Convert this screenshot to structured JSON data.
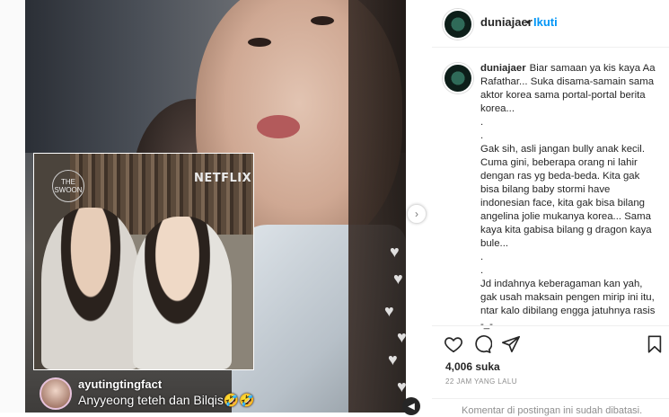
{
  "post": {
    "username": "duniajaer",
    "separator": "•",
    "follow_label": "Ikuti",
    "caption_lines": "Biar samaan ya kis kaya Aa Rafathar... Suka disama-samain sama aktor korea sama portal-portal berita korea...\n.\n.\nGak sih, asli jangan bully anak kecil. Cuma gini, beberapa orang ni lahir dengan ras yg beda-beda. Kita gak bisa bilang baby stormi have indonesian face, kita gak bisa bilang angelina jolie mukanya korea... Sama kaya kita gabisa bilang g dragon kaya bule...\n.\n.\nJd indahnya keberagaman kan yah, gak usah maksain pengen mirip ini itu, ntar kalo dibilang engga jatuhnya rasis -_-",
    "likes": "4,006 suka",
    "timestamp": "22 JAM YANG LALU",
    "comments_off": "Komentar di postingan ini sudah dibatasi."
  },
  "media": {
    "inset_brand": "NETFLIX",
    "inset_logo": "THE SWOON",
    "watermark_user": "ayutingtingfact",
    "watermark_caption": "Anyyeong teteh dan Bilqis🤣🤣"
  },
  "icons": [
    "heart-icon",
    "comment-icon",
    "share-icon",
    "bookmark-icon",
    "chevron-right-icon",
    "sound-icon"
  ],
  "colors": {
    "link_blue": "#0095f6",
    "text": "#262626",
    "muted": "#8e8e8e"
  }
}
